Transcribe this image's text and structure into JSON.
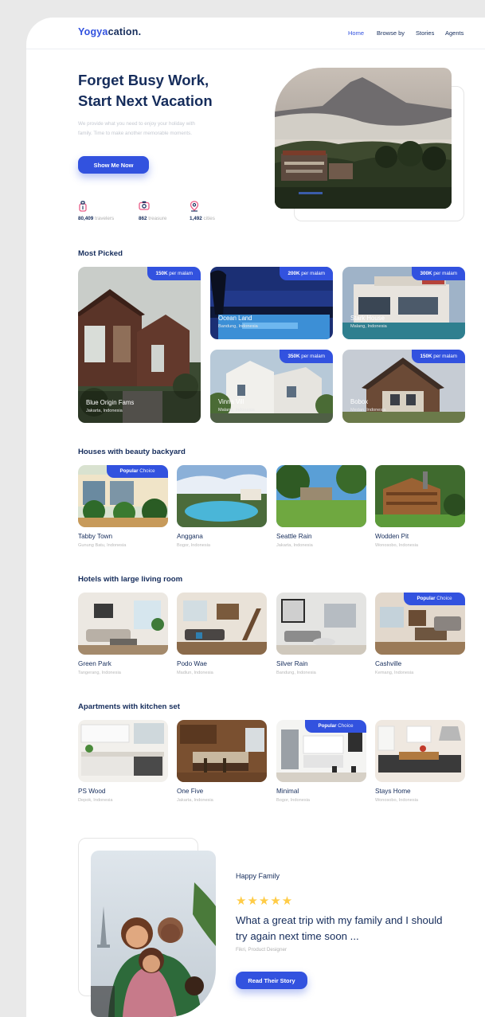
{
  "brand": {
    "part1": "Yogya",
    "part2": "cation."
  },
  "nav": {
    "home": "Home",
    "browse": "Browse by",
    "stories": "Stories",
    "agents": "Agents"
  },
  "hero": {
    "title_line1": "Forget Busy Work,",
    "title_line2": "Start Next Vacation",
    "description": "We provide what you need to enjoy your holiday with family. Time to make another memorable moments.",
    "cta": "Show Me Now",
    "stats": [
      {
        "value": "80,409",
        "label": "travelers",
        "icon": "traveler-icon"
      },
      {
        "value": "862",
        "label": "treasure",
        "icon": "camera-icon"
      },
      {
        "value": "1,492",
        "label": "cities",
        "icon": "location-pin-icon"
      }
    ]
  },
  "most_picked": {
    "title": "Most Picked",
    "price_suffix": "per malam",
    "items": [
      {
        "price": "150K",
        "name": "Blue Origin Fams",
        "location": "Jakarta, Indonesia"
      },
      {
        "price": "200K",
        "name": "Ocean Land",
        "location": "Bandung, Indonesia"
      },
      {
        "price": "300K",
        "name": "Stark House",
        "location": "Malang, Indonesia"
      },
      {
        "price": "350K",
        "name": "Vinna Vill",
        "location": "Malang, Indonesia"
      },
      {
        "price": "150K",
        "name": "Bobox",
        "location": "Medan, Indonesia"
      }
    ]
  },
  "popular_badge": {
    "bold": "Popular",
    "rest": " Choice"
  },
  "backyard": {
    "title": "Houses with beauty backyard",
    "items": [
      {
        "name": "Tabby Town",
        "location": "Gunung Batu, Indonesia"
      },
      {
        "name": "Anggana",
        "location": "Bogor, Indonesia"
      },
      {
        "name": "Seattle Rain",
        "location": "Jakarta, Indonesia"
      },
      {
        "name": "Wodden Pit",
        "location": "Wonosobo, Indonesia"
      }
    ]
  },
  "living": {
    "title": "Hotels with large living room",
    "items": [
      {
        "name": "Green Park",
        "location": "Tangerang, Indonesia"
      },
      {
        "name": "Podo Wae",
        "location": "Madiun, Indonesia"
      },
      {
        "name": "Silver Rain",
        "location": "Bandung, Indonesia"
      },
      {
        "name": "Cashville",
        "location": "Kemang, Indonesia"
      }
    ]
  },
  "kitchen": {
    "title": "Apartments with kitchen set",
    "items": [
      {
        "name": "PS Wood",
        "location": "Depok, Indonesia"
      },
      {
        "name": "One Five",
        "location": "Jakarta, Indonesia"
      },
      {
        "name": "Minimal",
        "location": "Bogor, Indonesia"
      },
      {
        "name": "Stays Home",
        "location": "Wonosobo, Indonesia"
      }
    ]
  },
  "testimonial": {
    "title": "Happy Family",
    "stars": "★★★★★",
    "rating": 5,
    "quote": "What a great trip with my family and I should try again next time soon ...",
    "author": "Fikri, Product Designer",
    "cta": "Read Their Story"
  },
  "colors": {
    "primary": "#3252df",
    "navy": "#152c5b",
    "star": "#ffcc47",
    "muted": "#b0b0b0"
  }
}
